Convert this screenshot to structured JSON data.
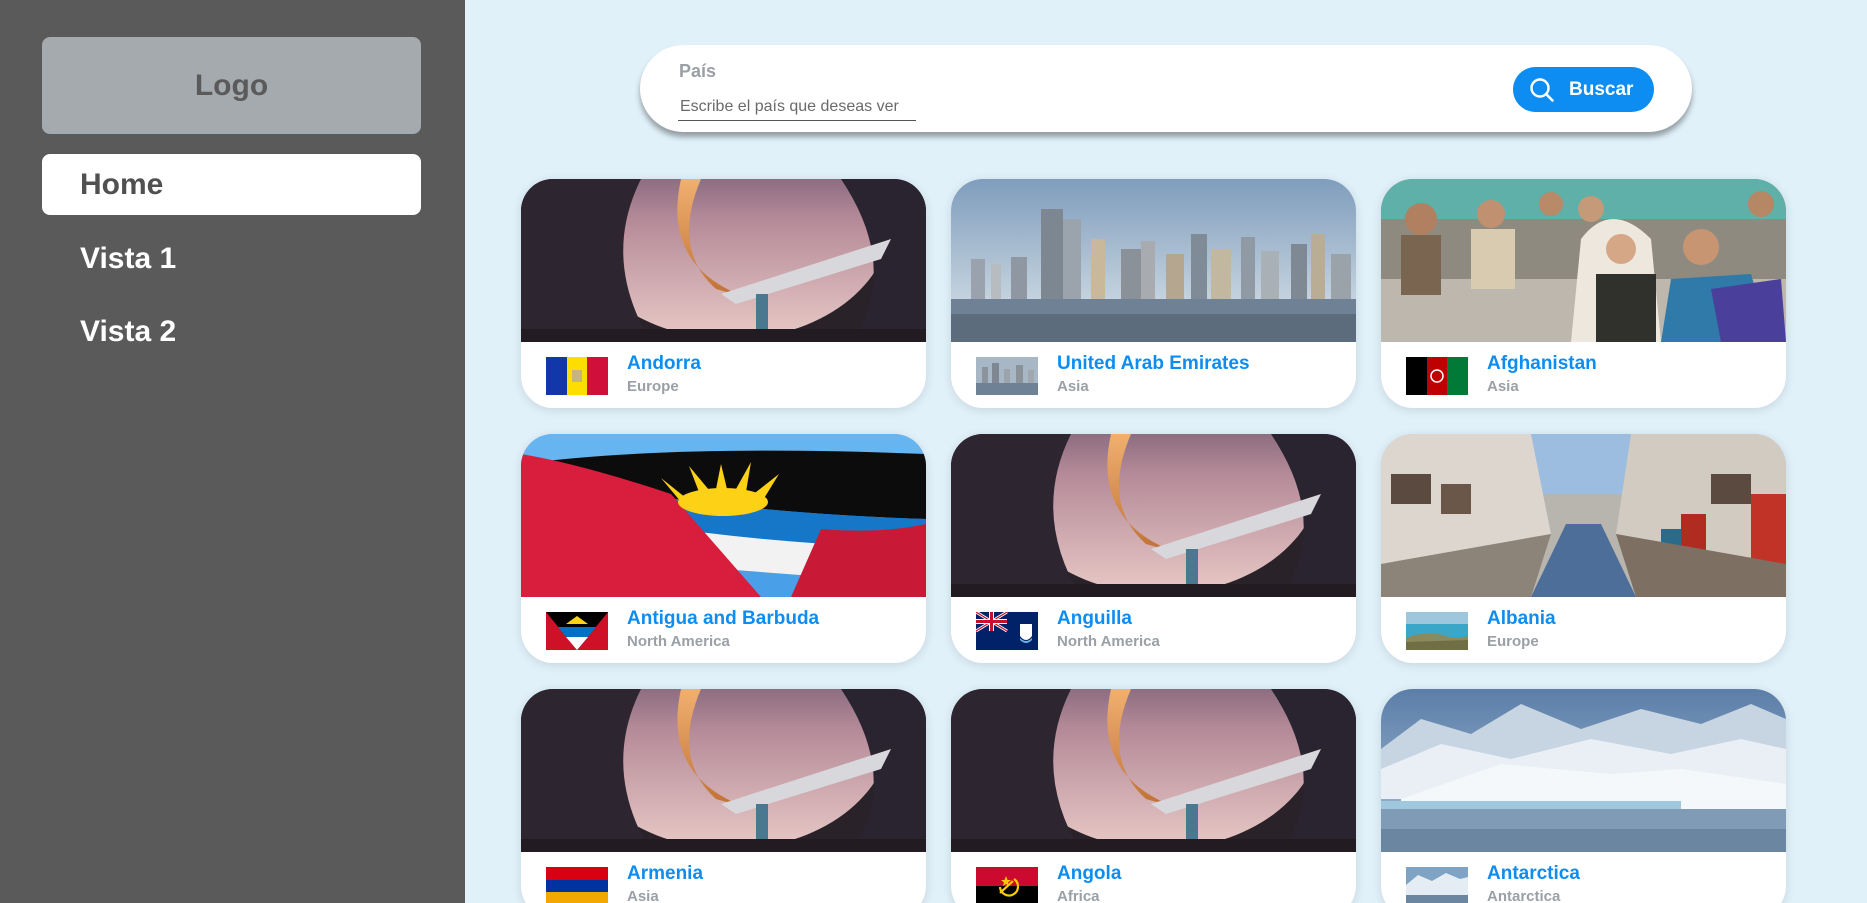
{
  "sidebar": {
    "logo": "Logo",
    "items": [
      {
        "label": "Home",
        "active": true
      },
      {
        "label": "Vista 1",
        "active": false
      },
      {
        "label": "Vista 2",
        "active": false
      }
    ]
  },
  "search": {
    "label": "País",
    "placeholder": "Escribe el país que deseas ver",
    "value": "",
    "button_label": "Buscar",
    "button_icon": "search-icon"
  },
  "colors": {
    "accent": "#0d8df2",
    "sidebar_bg": "#5a5a5a",
    "page_bg": "#e1f1fa",
    "logo_bg": "#a5aaae",
    "muted_text": "#9aa0a6"
  },
  "countries": [
    {
      "name": "Andorra",
      "region": "Europe",
      "image": "architecture-placeholder",
      "flag": "andorra-flag-icon"
    },
    {
      "name": "United Arab Emirates",
      "region": "Asia",
      "image": "city-skyline",
      "flag": "skyline-thumbnail"
    },
    {
      "name": "Afghanistan",
      "region": "Asia",
      "image": "children-group",
      "flag": "afghanistan-flag-icon"
    },
    {
      "name": "Antigua and Barbuda",
      "region": "North America",
      "image": "waving-flag",
      "flag": "antigua-flag-icon"
    },
    {
      "name": "Anguilla",
      "region": "North America",
      "image": "architecture-placeholder",
      "flag": "anguilla-flag-icon"
    },
    {
      "name": "Albania",
      "region": "Europe",
      "image": "market-street",
      "flag": "coast-thumbnail"
    },
    {
      "name": "Armenia",
      "region": "Asia",
      "image": "architecture-placeholder",
      "flag": "armenia-flag-icon"
    },
    {
      "name": "Angola",
      "region": "Africa",
      "image": "architecture-placeholder",
      "flag": "angola-flag-icon"
    },
    {
      "name": "Antarctica",
      "region": "Antarctica",
      "image": "glacier-landscape",
      "flag": "glacier-thumbnail"
    }
  ]
}
